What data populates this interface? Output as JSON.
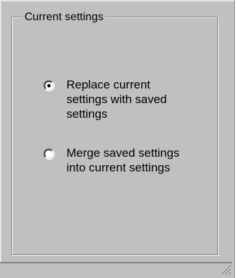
{
  "group": {
    "title": "Current settings"
  },
  "options": [
    {
      "label": "Replace current settings with saved settings",
      "selected": true
    },
    {
      "label": "Merge saved settings into current settings",
      "selected": false
    }
  ],
  "colors": {
    "face": "#c0c0c0",
    "shadow": "#808080",
    "highlight": "#ffffff",
    "text": "#000000"
  },
  "icons": {
    "radio_selected": "radio-selected-icon",
    "radio_unselected": "radio-unselected-icon",
    "size_grip": "size-grip-icon"
  }
}
